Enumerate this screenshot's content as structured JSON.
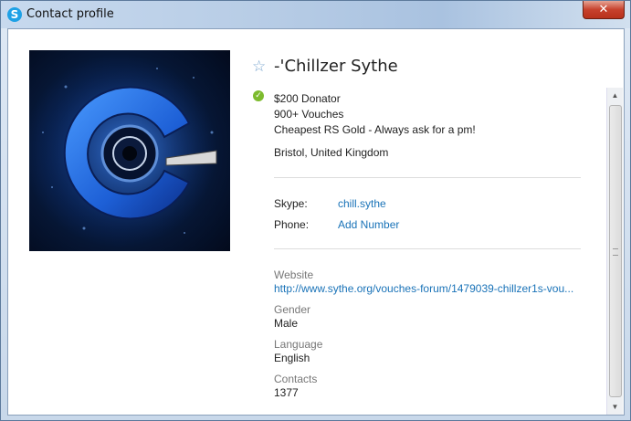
{
  "window": {
    "title": "Contact profile",
    "close_glyph": "✕"
  },
  "profile": {
    "display_name": "-'Chillzer Sythe",
    "favorite_icon": "star-outline-icon",
    "status_icon": "online-check-icon",
    "mood": [
      "$200 Donator",
      "900+ Vouches",
      "Cheapest RS Gold - Always ask for a pm!"
    ],
    "location": "Bristol, United Kingdom"
  },
  "contact": {
    "skype_label": "Skype:",
    "skype_value": "chill.sythe",
    "phone_label": "Phone:",
    "phone_value": "Add Number"
  },
  "details": {
    "website_label": "Website",
    "website_value": "http://www.sythe.org/vouches-forum/1479039-chillzer1s-vou...",
    "gender_label": "Gender",
    "gender_value": "Male",
    "language_label": "Language",
    "language_value": "English",
    "contacts_label": "Contacts",
    "contacts_value": "1377"
  },
  "colors": {
    "link": "#1a73b8",
    "online": "#7dbb2e",
    "skype_brand": "#1ea1e6"
  }
}
